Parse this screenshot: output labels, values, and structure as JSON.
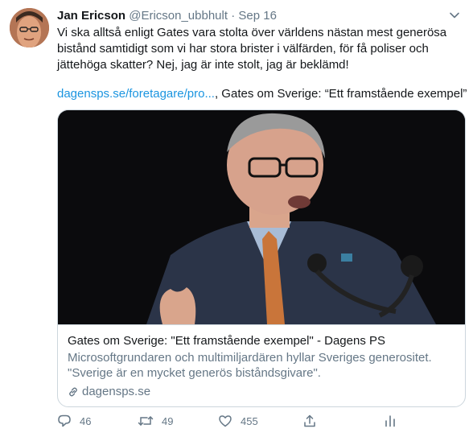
{
  "tweet": {
    "author_name": "Jan Ericson",
    "author_handle": "@Ericson_ubbhult",
    "separator": "·",
    "date": "Sep 16",
    "text_lines": [
      "Vi ska alltså enligt Gates vara stolta över världens nästan mest generösa",
      "bistånd samtidigt som vi har stora brister i välfärden, för få poliser och",
      "jättehöga skatter? Nej, jag är inte stolt, jag är beklämd!"
    ],
    "link_text": "dagensps.se/foretagare/pro...",
    "link_suffix": ", Gates om Sverige: “Ett framstående exempel”"
  },
  "card": {
    "title": "Gates om Sverige: \"Ett framstående exempel\" - Dagens PS",
    "description_lines": [
      "Microsoftgrundaren och multimiljardären hyllar Sveriges generositet.",
      "\"Sverige är en mycket generös biståndsgivare\"."
    ],
    "domain": "dagensps.se"
  },
  "actions": {
    "reply_count": "46",
    "retweet_count": "49",
    "like_count": "455"
  },
  "icons": {
    "caret": "chevron-down-icon",
    "reply": "reply-icon",
    "retweet": "retweet-icon",
    "like": "heart-icon",
    "share": "share-icon",
    "analytics": "analytics-icon",
    "link": "link-icon"
  },
  "colors": {
    "link": "#1b95e0",
    "secondary_text": "#657786",
    "border": "#ccd6dd"
  }
}
